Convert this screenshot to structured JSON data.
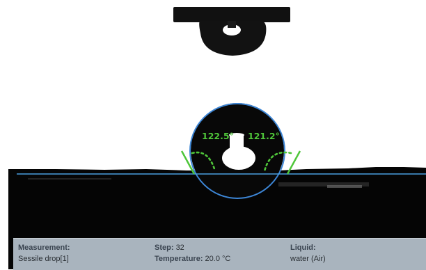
{
  "measurement": {
    "left_angle": "122.5°",
    "right_angle": "121.2°"
  },
  "status_bar": {
    "measurement_label": "Measurement:",
    "measurement_value": "Sessile drop[1]",
    "step_label": "Step:",
    "step_value": "32",
    "temperature_label": "Temperature:",
    "temperature_value": "20.0 °C",
    "liquid_label": "Liquid:",
    "liquid_value": "water (Air)"
  },
  "colors": {
    "fit_circle": "#3d86d6",
    "baseline": "#4a9fe0",
    "tangent": "#4fc63a",
    "status_bar_bg": "#a9b4be"
  }
}
